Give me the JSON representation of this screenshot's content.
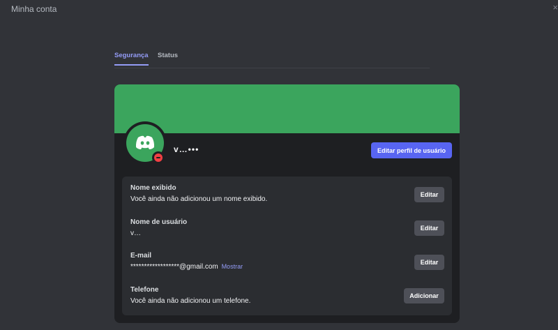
{
  "window": {
    "title": "Minha conta",
    "close_glyph": "×"
  },
  "tabs": [
    {
      "label": "Segurança",
      "active": true
    },
    {
      "label": "Status",
      "active": false
    }
  ],
  "profile": {
    "username": "v…•••",
    "edit_profile_label": "Editar perfil de usuário",
    "banner_color": "#3ba55d",
    "status": "do-not-disturb"
  },
  "fields": [
    {
      "label": "Nome exibido",
      "value": "Você ainda não adicionou um nome exibido.",
      "button": "Editar"
    },
    {
      "label": "Nome de usuário",
      "value": "v…",
      "button": "Editar"
    },
    {
      "label": "E-mail",
      "value": "******************@gmail.com",
      "reveal": "Mostrar",
      "button": "Editar"
    },
    {
      "label": "Telefone",
      "value": "Você ainda não adicionou um telefone.",
      "button": "Adicionar"
    }
  ]
}
